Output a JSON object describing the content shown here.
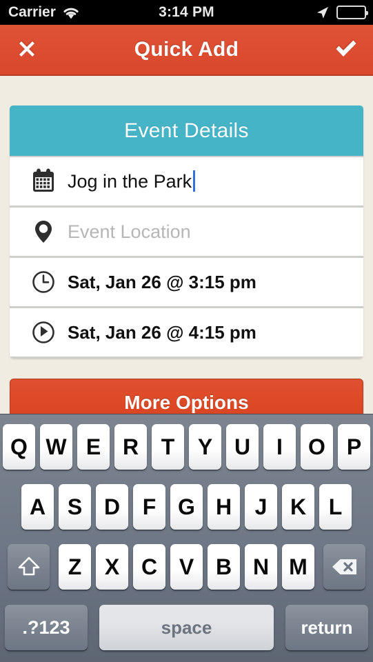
{
  "status_bar": {
    "carrier": "Carrier",
    "time": "3:14 PM",
    "wifi_icon": "wifi-icon",
    "location_icon": "location-arrow-icon",
    "battery_icon": "battery-icon"
  },
  "nav_bar": {
    "title": "Quick Add",
    "cancel_icon": "close-x-icon",
    "done_icon": "checkmark-icon",
    "background_color": "#d9472c"
  },
  "card": {
    "header_title": "Event Details",
    "header_color": "#45b4c7",
    "rows": [
      {
        "icon": "calendar-icon",
        "value": "Jog in the Park",
        "placeholder": "Event Title",
        "has_caret": true,
        "is_placeholder": false
      },
      {
        "icon": "map-pin-icon",
        "value": "",
        "placeholder": "Event Location",
        "has_caret": false,
        "is_placeholder": true
      },
      {
        "icon": "clock-start-icon",
        "value": "Sat, Jan 26 @ 3:15 pm",
        "placeholder": "Start Time",
        "has_caret": false,
        "is_placeholder": false
      },
      {
        "icon": "clock-end-icon",
        "value": "Sat, Jan 26 @ 4:15 pm",
        "placeholder": "End Time",
        "has_caret": false,
        "is_placeholder": false
      }
    ]
  },
  "more_options": {
    "label": "More Options",
    "color": "#d8431f"
  },
  "keyboard": {
    "row1": [
      "Q",
      "W",
      "E",
      "R",
      "T",
      "Y",
      "U",
      "I",
      "O",
      "P"
    ],
    "row2": [
      "A",
      "S",
      "D",
      "F",
      "G",
      "H",
      "J",
      "K",
      "L"
    ],
    "row3": [
      "Z",
      "X",
      "C",
      "V",
      "B",
      "N",
      "M"
    ],
    "shift_icon": "shift-up-arrow-icon",
    "backspace_icon": "backspace-delete-icon",
    "numeric_label": ".?123",
    "space_label": "space",
    "return_label": "return"
  }
}
